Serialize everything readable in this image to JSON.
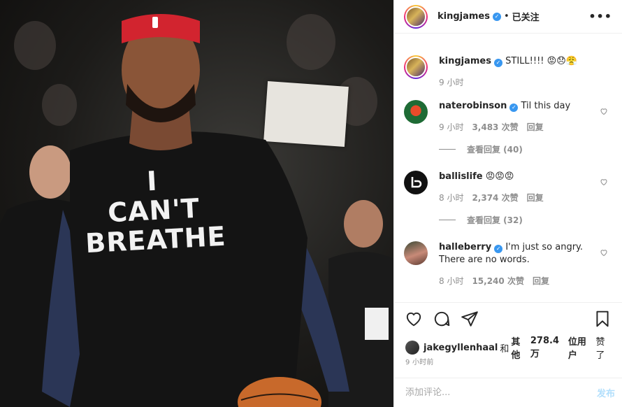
{
  "media": {
    "shirt_lines": [
      "I",
      "CAN'T",
      "BREATHE"
    ]
  },
  "header": {
    "username": "kingjames",
    "separator": "•",
    "follow_status": "已关注",
    "more_icon": "more-horizontal-icon"
  },
  "caption": {
    "username": "kingjames",
    "text": "STILL!!!!",
    "emojis": [
      "😡",
      "😞",
      "😤"
    ],
    "time": "9 小时"
  },
  "comments": [
    {
      "username": "naterobinson",
      "verified": true,
      "text": "Til this day",
      "time": "9 小时",
      "likes": "3,483 次赞",
      "reply": "回复",
      "view_replies": "查看回复 (40)"
    },
    {
      "username": "ballislife",
      "verified": false,
      "text": "😡😡😡",
      "time": "8 小时",
      "likes": "2,374 次赞",
      "reply": "回复",
      "view_replies": "查看回复 (32)"
    },
    {
      "username": "halleberry",
      "verified": true,
      "text": "I'm just so angry. There are no words.",
      "time": "8 小时",
      "likes": "15,240 次赞",
      "reply": "回复"
    }
  ],
  "actions": {
    "like_icon": "heart-icon",
    "comment_icon": "comment-icon",
    "share_icon": "send-icon",
    "save_icon": "bookmark-icon"
  },
  "liked_by": {
    "user": "jakegyllenhaal",
    "conj": "和",
    "others_label": "其他",
    "count": "278.4万",
    "suffix": "位用户",
    "verb": "赞了"
  },
  "post_time": "9 小时前",
  "add_comment": {
    "placeholder": "添加评论...",
    "post_label": "发布"
  },
  "colors": {
    "verified": "#3897f0",
    "text": "#262626",
    "muted": "#8e8e8e",
    "post_disabled": "#b2dffc"
  }
}
